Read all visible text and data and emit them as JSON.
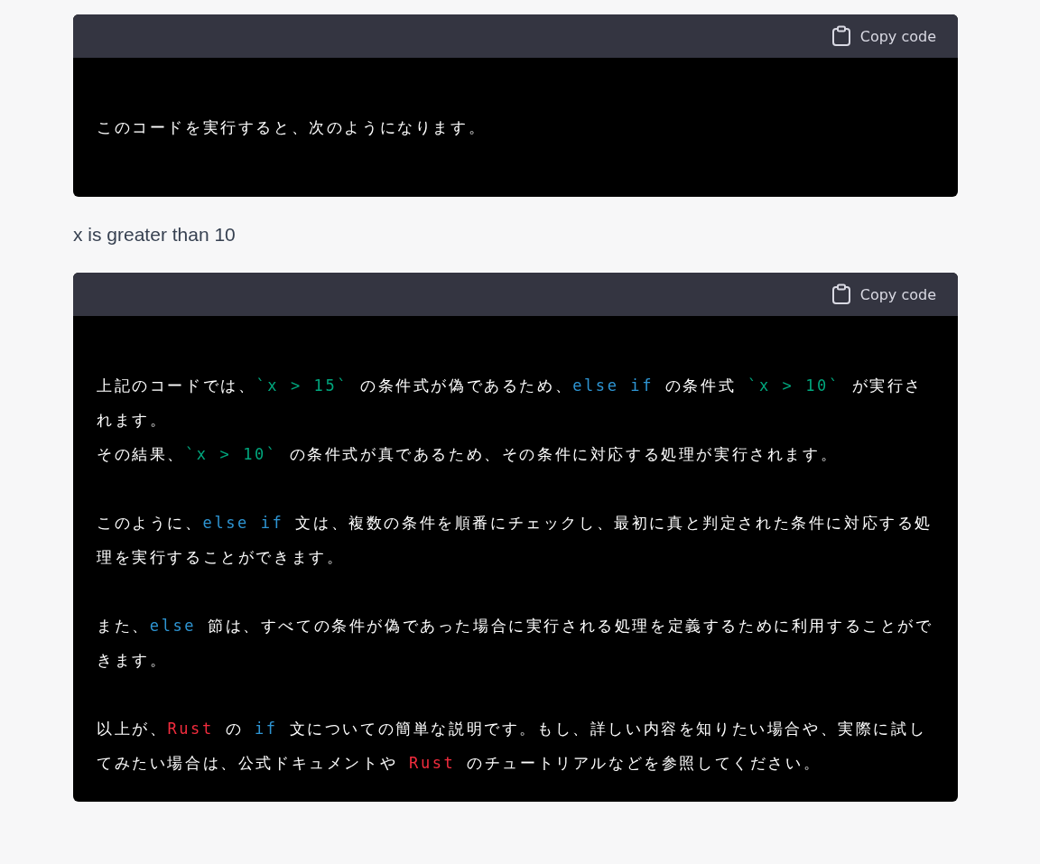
{
  "blocks": [
    {
      "kind": "code",
      "copy_label": "Copy code",
      "paragraphs": [
        [
          [
            {
              "kind": "plain",
              "text": "このコードを実行すると、次のようになります。"
            }
          ]
        ]
      ]
    },
    {
      "kind": "text",
      "text": "x is greater than 10"
    },
    {
      "kind": "code",
      "copy_label": "Copy code",
      "paragraphs": [
        [
          [
            {
              "kind": "plain",
              "text": "上記のコードでは、"
            },
            {
              "kind": "string",
              "text": "`x > 15`"
            },
            {
              "kind": "plain",
              "text": " の条件式が偽であるため、"
            },
            {
              "kind": "keyword",
              "text": "else if"
            },
            {
              "kind": "plain",
              "text": " の条件式 "
            },
            {
              "kind": "string",
              "text": "`x > 10`"
            },
            {
              "kind": "plain",
              "text": " が実行されます。"
            }
          ],
          [
            {
              "kind": "plain",
              "text": "その結果、"
            },
            {
              "kind": "string",
              "text": "`x > 10`"
            },
            {
              "kind": "plain",
              "text": " の条件式が真であるため、その条件に対応する処理が実行されます。"
            }
          ]
        ],
        [
          [
            {
              "kind": "plain",
              "text": "このように、"
            },
            {
              "kind": "keyword",
              "text": "else if"
            },
            {
              "kind": "plain",
              "text": " 文は、複数の条件を順番にチェックし、最初に真と判定された条件に対応する処理を実行することができます。"
            }
          ]
        ],
        [
          [
            {
              "kind": "plain",
              "text": "また、"
            },
            {
              "kind": "keyword",
              "text": "else"
            },
            {
              "kind": "plain",
              "text": " 節は、すべての条件が偽であった場合に実行される処理を定義するために利用することができます。"
            }
          ]
        ],
        [
          [
            {
              "kind": "plain",
              "text": "以上が、"
            },
            {
              "kind": "name",
              "text": "Rust"
            },
            {
              "kind": "plain",
              "text": " の "
            },
            {
              "kind": "keyword",
              "text": "if"
            },
            {
              "kind": "plain",
              "text": " 文についての簡単な説明です。もし、詳しい内容を知りたい場合や、実際に試してみたい場合は、公式ドキュメントや "
            },
            {
              "kind": "name",
              "text": "Rust"
            },
            {
              "kind": "plain",
              "text": " のチュートリアルなどを参照してください。"
            }
          ]
        ]
      ]
    }
  ]
}
